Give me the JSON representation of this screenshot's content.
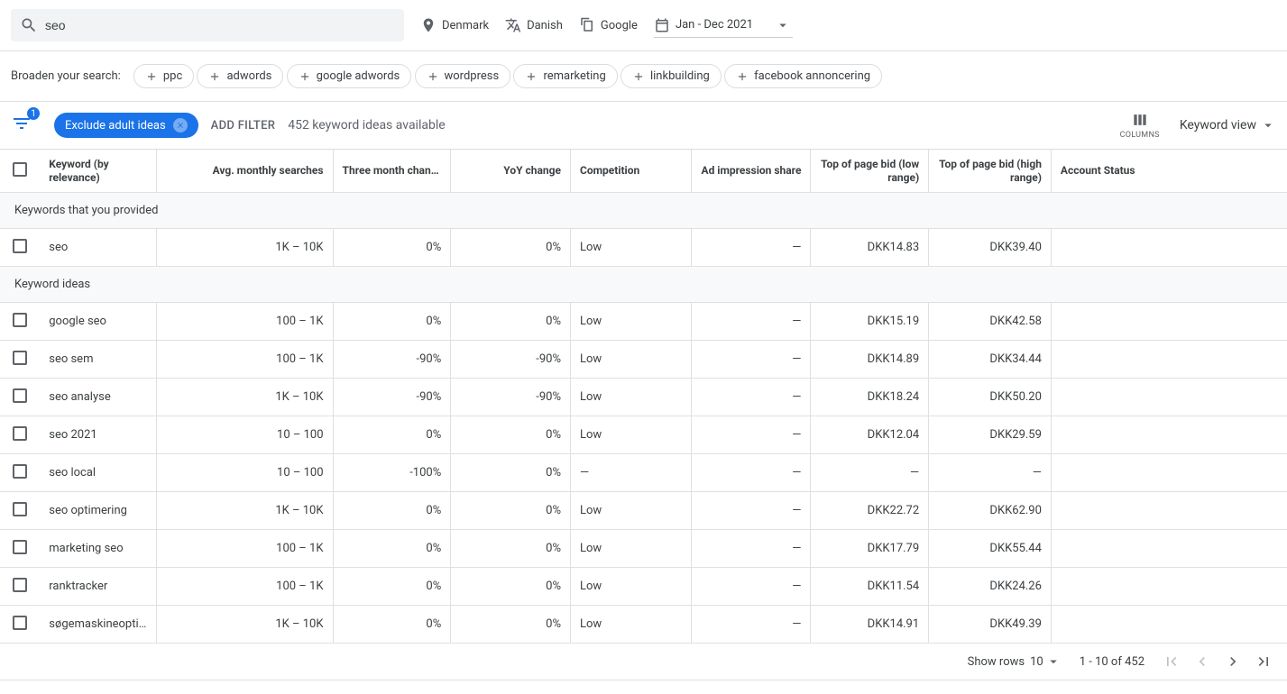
{
  "search": {
    "value": "seo"
  },
  "filters": {
    "location": "Denmark",
    "language": "Danish",
    "network": "Google",
    "date_range": "Jan - Dec 2021"
  },
  "broaden": {
    "label": "Broaden your search:",
    "chips": [
      "ppc",
      "adwords",
      "google adwords",
      "wordpress",
      "remarketing",
      "linkbuilding",
      "facebook annoncering"
    ]
  },
  "toolbar": {
    "badge": "1",
    "exclude_label": "Exclude adult ideas",
    "add_filter": "ADD FILTER",
    "ideas_available": "452 keyword ideas available",
    "columns_label": "COLUMNS",
    "view_label": "Keyword view"
  },
  "table": {
    "headers": {
      "keyword": "Keyword (by relevance)",
      "avg": "Avg. monthly searches",
      "three_month": "Three month change",
      "yoy": "YoY change",
      "competition": "Competition",
      "impression": "Ad impression share",
      "bid_low": "Top of page bid (low range)",
      "bid_high": "Top of page bid (high range)",
      "status": "Account Status"
    },
    "section_provided": "Keywords that you provided",
    "section_ideas": "Keyword ideas",
    "provided": [
      {
        "keyword": "seo",
        "avg": "1K – 10K",
        "three_month": "0%",
        "yoy": "0%",
        "competition": "Low",
        "impression": "—",
        "bid_low": "DKK14.83",
        "bid_high": "DKK39.40",
        "status": ""
      }
    ],
    "ideas": [
      {
        "keyword": "google seo",
        "avg": "100 – 1K",
        "three_month": "0%",
        "yoy": "0%",
        "competition": "Low",
        "impression": "—",
        "bid_low": "DKK15.19",
        "bid_high": "DKK42.58",
        "status": ""
      },
      {
        "keyword": "seo sem",
        "avg": "100 – 1K",
        "three_month": "-90%",
        "yoy": "-90%",
        "competition": "Low",
        "impression": "—",
        "bid_low": "DKK14.89",
        "bid_high": "DKK34.44",
        "status": ""
      },
      {
        "keyword": "seo analyse",
        "avg": "1K – 10K",
        "three_month": "-90%",
        "yoy": "-90%",
        "competition": "Low",
        "impression": "—",
        "bid_low": "DKK18.24",
        "bid_high": "DKK50.20",
        "status": ""
      },
      {
        "keyword": "seo 2021",
        "avg": "10 – 100",
        "three_month": "0%",
        "yoy": "0%",
        "competition": "Low",
        "impression": "—",
        "bid_low": "DKK12.04",
        "bid_high": "DKK29.59",
        "status": ""
      },
      {
        "keyword": "seo local",
        "avg": "10 – 100",
        "three_month": "-100%",
        "yoy": "0%",
        "competition": "—",
        "impression": "—",
        "bid_low": "—",
        "bid_high": "—",
        "status": ""
      },
      {
        "keyword": "seo optimering",
        "avg": "1K – 10K",
        "three_month": "0%",
        "yoy": "0%",
        "competition": "Low",
        "impression": "—",
        "bid_low": "DKK22.72",
        "bid_high": "DKK62.90",
        "status": ""
      },
      {
        "keyword": "marketing seo",
        "avg": "100 – 1K",
        "three_month": "0%",
        "yoy": "0%",
        "competition": "Low",
        "impression": "—",
        "bid_low": "DKK17.79",
        "bid_high": "DKK55.44",
        "status": ""
      },
      {
        "keyword": "ranktracker",
        "avg": "100 – 1K",
        "three_month": "0%",
        "yoy": "0%",
        "competition": "Low",
        "impression": "—",
        "bid_low": "DKK11.54",
        "bid_high": "DKK24.26",
        "status": ""
      },
      {
        "keyword": "søgemaskineoptim…",
        "avg": "1K – 10K",
        "three_month": "0%",
        "yoy": "0%",
        "competition": "Low",
        "impression": "—",
        "bid_low": "DKK14.91",
        "bid_high": "DKK49.39",
        "status": ""
      }
    ]
  },
  "pager": {
    "show_rows_label": "Show rows",
    "show_rows_value": "10",
    "range": "1 - 10 of 452"
  }
}
